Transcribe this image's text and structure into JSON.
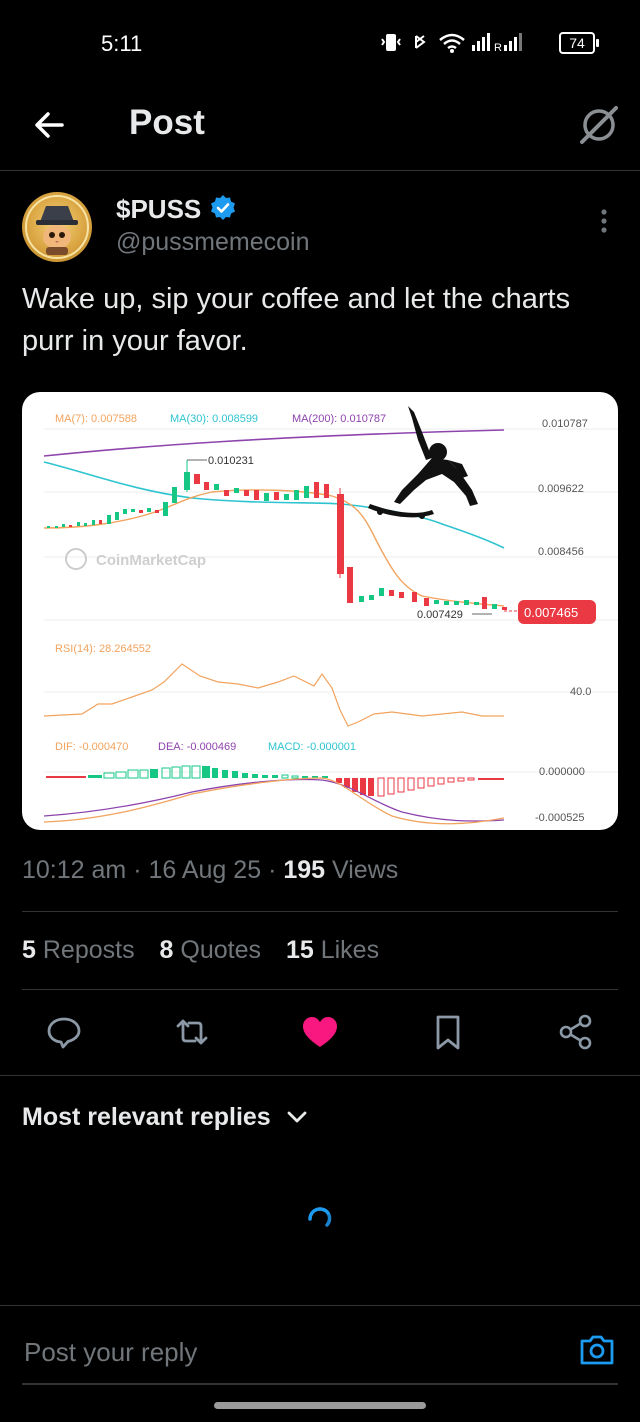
{
  "status_bar": {
    "time": "5:11",
    "battery": "74"
  },
  "header": {
    "title": "Post"
  },
  "post": {
    "display_name": "$PUSS",
    "handle": "@pussmemecoin",
    "text": "Wake up, sip your coffee and let the charts purr in your favor.",
    "time": "10:12 am",
    "date": "16 Aug 25",
    "views_count": "195",
    "views_label": "Views",
    "reposts_count": "5",
    "reposts_label": "Reposts",
    "quotes_count": "8",
    "quotes_label": "Quotes",
    "likes_count": "15",
    "likes_label": "Likes",
    "liked": true,
    "colors": {
      "like": "#f91880",
      "verified": "#1d9bf0",
      "muted": "#71767b"
    }
  },
  "chart_image": {
    "ma_legend": [
      "MA(7): 0.007588",
      "MA(30): 0.008599",
      "MA(200): 0.010787"
    ],
    "price_ticks": [
      "0.010787",
      "0.009622",
      "0.008456"
    ],
    "high_label": "0.010231",
    "low_label": "0.007429",
    "current_price": "0.007465",
    "watermark": "CoinMarketCap",
    "rsi_label": "RSI(14): 28.264552",
    "rsi_tick": "40.0",
    "macd_dif": "DIF: -0.000470",
    "macd_dea": "DEA: -0.000469",
    "macd_val": "MACD: -0.000001",
    "macd_ticks": [
      "0.000000",
      "-0.000525"
    ]
  },
  "replies": {
    "sort_label": "Most relevant replies"
  },
  "reply_bar": {
    "placeholder": "Post your reply"
  },
  "icons": [
    "back-arrow-icon",
    "grok-icon",
    "verified-badge-icon",
    "more-vertical-icon",
    "reply-icon",
    "repost-icon",
    "heart-icon",
    "bookmark-icon",
    "share-icon",
    "chevron-down-icon",
    "loading-spinner-icon",
    "camera-icon"
  ]
}
